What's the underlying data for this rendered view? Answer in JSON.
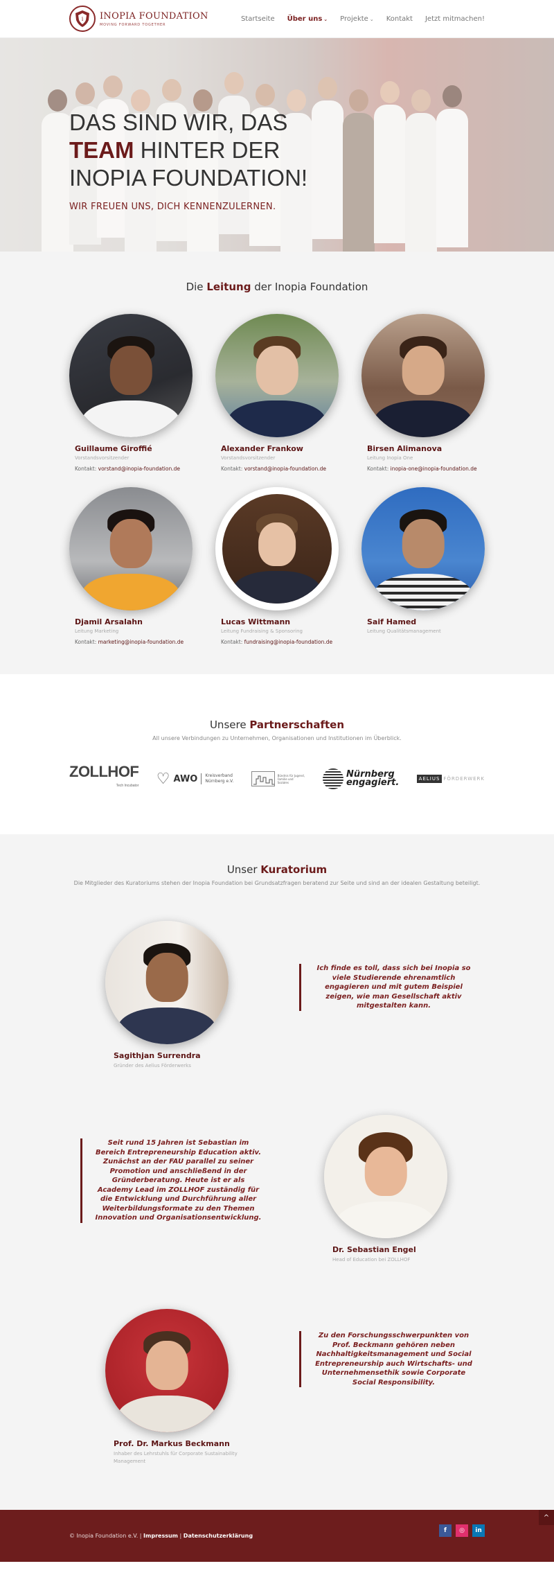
{
  "header": {
    "logo_name": "INOPIA FOUNDATION",
    "logo_tagline": "MOVING FORWARD TOGETHER",
    "nav": [
      {
        "label": "Startseite"
      },
      {
        "label": "Über uns"
      },
      {
        "label": "Projekte"
      },
      {
        "label": "Kontakt"
      },
      {
        "label": "Jetzt mitmachen!"
      }
    ]
  },
  "hero": {
    "line1": "DAS SIND WIR, DAS",
    "line2_bold": "TEAM",
    "line2_rest": " HINTER DER",
    "line3": "INOPIA FOUNDATION!",
    "subtitle": "WIR FREUEN UNS, DICH KENNENZULERNEN."
  },
  "team": {
    "title_pre": "Die ",
    "title_bold": "Leitung",
    "title_post": " der Inopia Foundation",
    "members": [
      {
        "name": "Guillaume Giroffié",
        "role": "Vorstandsvorsitzender",
        "contact_label": "Kontakt: ",
        "email": "vorstand@inopia-foundation.de"
      },
      {
        "name": "Alexander Frankow",
        "role": "Vorstandsvorsitzender",
        "contact_label": "Kontakt: ",
        "email": "vorstand@inopia-foundation.de"
      },
      {
        "name": "Birsen Alimanova",
        "role": "Leitung Inopia One",
        "contact_label": "Kontakt: ",
        "email": "inopia-one@inopia-foundation.de"
      },
      {
        "name": "Djamil Arsalahn",
        "role": "Leitung Marketing",
        "contact_label": "Kontakt: ",
        "email": "marketing@inopia-foundation.de"
      },
      {
        "name": "Lucas Wittmann",
        "role": "Leitung Fundraising & Sponsoring",
        "contact_label": "Kontakt: ",
        "email": "fundraising@inopia-foundation.de"
      },
      {
        "name": "Saif Hamed",
        "role": "Leitung Qualitätsmanagement"
      }
    ]
  },
  "partners": {
    "title_pre": "Unsere ",
    "title_bold": "Partnerschaften",
    "subtitle": "All unsere Verbindungen zu Unternehmen, Organisationen und Institutionen im Überblick.",
    "logos": {
      "zollhof": "ZOLLHOF",
      "zollhof_sub": "Tech Incubator",
      "awo": "AWO",
      "awo_sub1": "Kreisverband",
      "awo_sub2": "Nürnberg e.V.",
      "bzg_sub": "Bündnis für Jugend, Familie und Soziales",
      "nuernberg1": "Nürnberg",
      "nuernberg2": "engagiert.",
      "aelius1": "AELIUS",
      "aelius2": "FÖRDERWERK"
    }
  },
  "kuratorium": {
    "title_pre": "Unser ",
    "title_bold": "Kuratorium",
    "subtitle": "Die Mitglieder des Kuratoriums stehen der Inopia Foundation bei Grundsatzfragen beratend zur Seite und sind an der idealen Gestaltung beteiligt.",
    "members": [
      {
        "name": "Sagithjan Surrendra",
        "role": "Gründer des Aelius Förderwerks",
        "quote": "Ich finde es toll, dass sich bei Inopia so viele Studierende ehrenamtlich engagieren und mit gutem Beispiel zeigen, wie man Gesellschaft aktiv mitgestalten kann."
      },
      {
        "name": "Dr. Sebastian Engel",
        "role": "Head of Education bei ZOLLHOF",
        "quote": "Seit rund 15 Jahren ist Sebastian im Bereich Entrepreneurship Education aktiv. Zunächst an der FAU parallel zu seiner Promotion und anschließend in der Gründerberatung. Heute ist er als Academy Lead im ZOLLHOF zuständig für die Entwicklung und Durchführung aller Weiterbildungsformate zu den Themen Innovation und Organisationsentwicklung."
      },
      {
        "name": "Prof. Dr. Markus Beckmann",
        "role": "Inhaber des Lehrstuhls für Corporate Sustainability Management",
        "quote": "Zu den Forschungsschwerpunkten von Prof. Beckmann gehören neben Nachhaltigkeitsmanagement und Social Entrepreneurship auch Wirtschafts- und Unternehmensethik sowie Corporate Social Responsibility."
      }
    ]
  },
  "footer": {
    "copyright": "© Inopia Foundation e.V. | ",
    "impressum": "Impressum",
    "sep": " | ",
    "datenschutz": "Datenschutzerklärung",
    "social": {
      "facebook": "f",
      "instagram": "◎",
      "linkedin": "in"
    },
    "totop": "^"
  }
}
